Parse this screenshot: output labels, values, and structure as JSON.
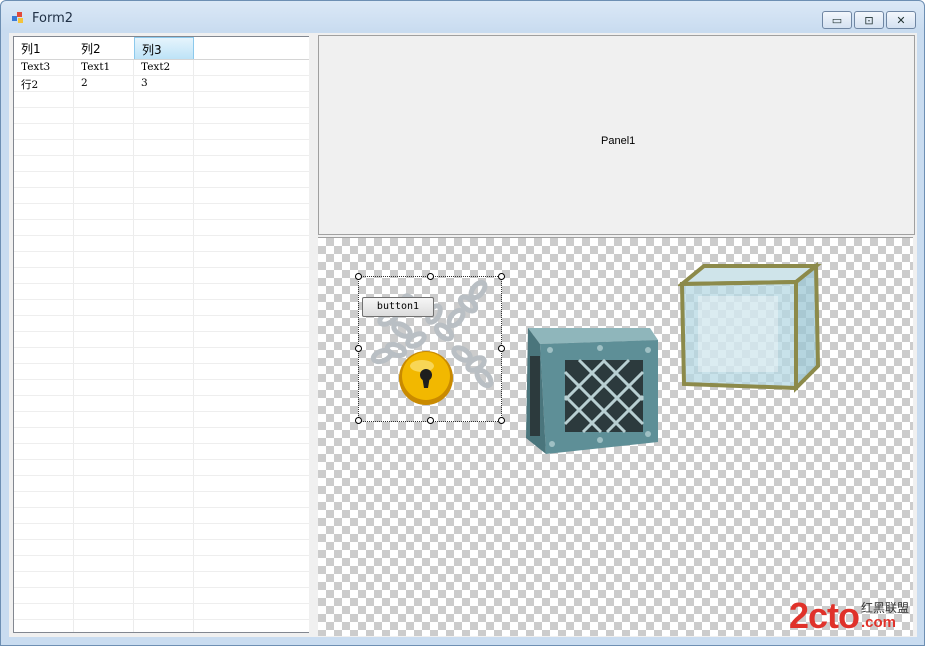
{
  "window": {
    "title": "Form2"
  },
  "controls": {
    "minimize": "▭",
    "maximize": "⊡",
    "close": "✕"
  },
  "grid": {
    "columns": [
      "列1",
      "列2",
      "列3"
    ],
    "rows": [
      [
        "Text3",
        "Text1",
        "Text2"
      ],
      [
        "行2",
        "2",
        "3"
      ]
    ]
  },
  "panel1": {
    "label": "Panel1"
  },
  "panel2": {
    "button_label": "button1"
  },
  "watermark": {
    "logo": "2cto",
    "cn": "红黑联盟",
    "domain": ".com"
  },
  "colors": {
    "accent": "#e0322a",
    "selected_header": "#bde3f7",
    "lock_gold": "#f2b800",
    "crate": "#5e8f97"
  }
}
